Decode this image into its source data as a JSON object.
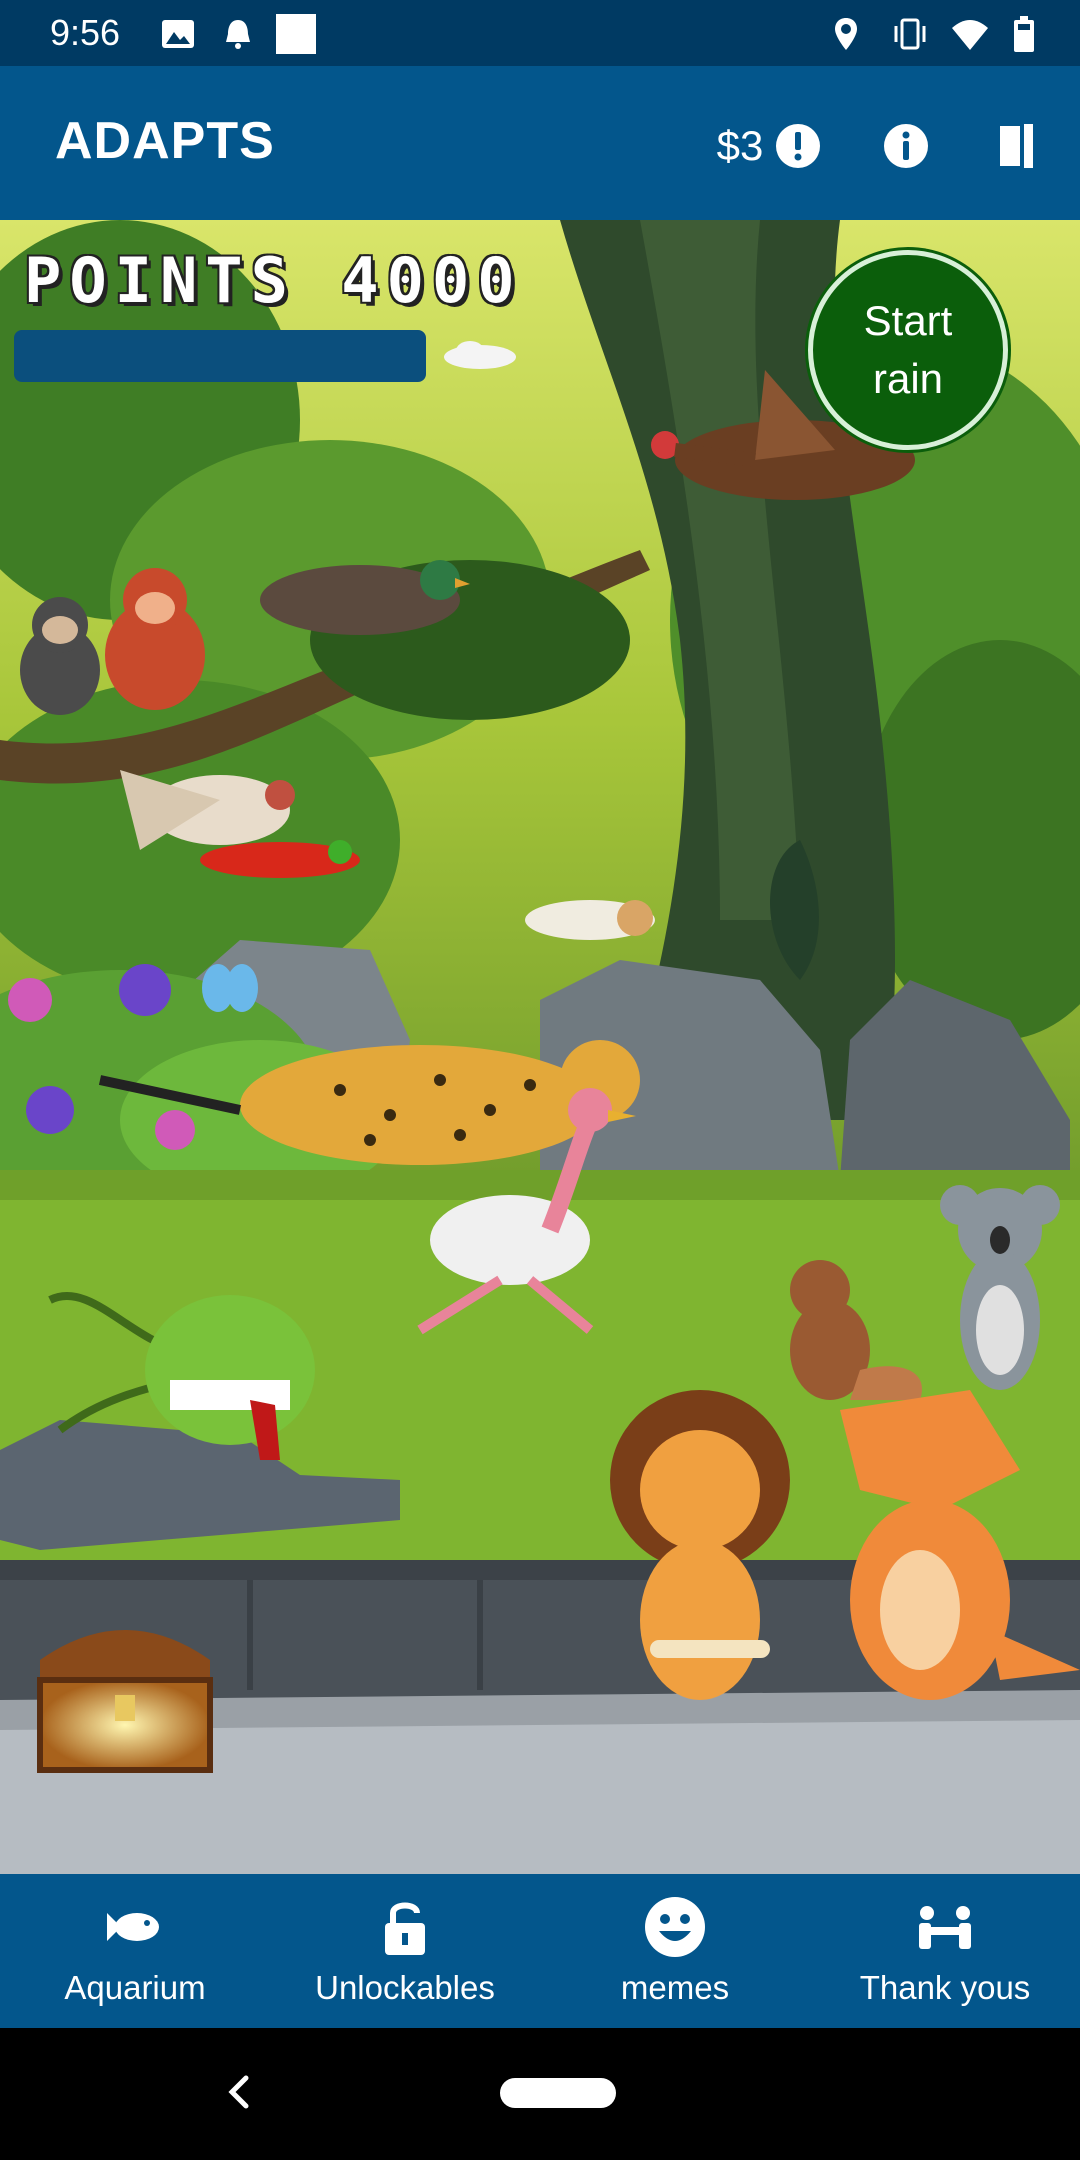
{
  "status_bar": {
    "time": "9:56",
    "left_icons": [
      "image-icon",
      "bell-icon",
      "square-icon"
    ],
    "right_icons": [
      "location-icon",
      "vibrate-icon",
      "wifi-icon",
      "battery-icon"
    ]
  },
  "app_bar": {
    "title": "ADAPTS",
    "money": "$3",
    "icons": [
      "alert-icon",
      "info-icon",
      "book-icon"
    ]
  },
  "game": {
    "points_label": "POINTS",
    "points_value": "4000",
    "progress_fraction": 0,
    "start_rain_label": "Start\nrain",
    "characters": [
      "monkey",
      "orangutan",
      "duck",
      "bird",
      "parrot",
      "owl",
      "vulture",
      "cheetah",
      "ostrich",
      "venus-flytrap",
      "squirrel",
      "koala",
      "lion",
      "triceratops",
      "treasure-chest",
      "butterfly"
    ]
  },
  "bottom_nav": {
    "items": [
      {
        "label": "Aquarium",
        "icon": "fish-icon"
      },
      {
        "label": "Unlockables",
        "icon": "unlock-icon"
      },
      {
        "label": "memes",
        "icon": "smiley-icon"
      },
      {
        "label": "Thank yous",
        "icon": "handshake-icon"
      }
    ]
  },
  "colors": {
    "status_bar": "#003a63",
    "app_bar": "#03568c",
    "rain_button": "#0b5e0b"
  }
}
